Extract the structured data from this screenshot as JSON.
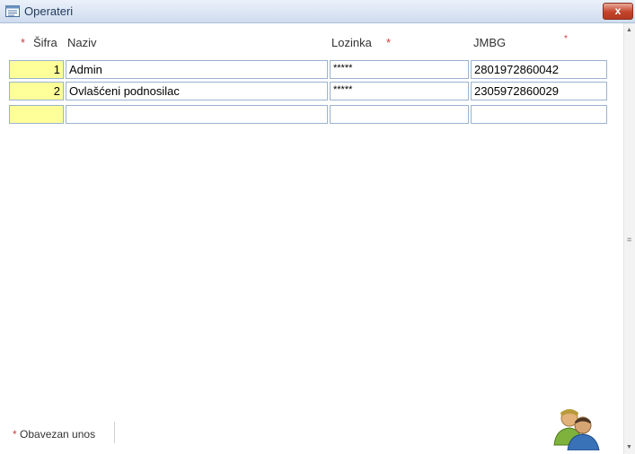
{
  "window": {
    "title": "Operateri",
    "close_label": "x"
  },
  "columns": {
    "sifra": "Šifra",
    "naziv": "Naziv",
    "lozinka": "Lozinka",
    "jmbg": "JMBG",
    "required_mark": "*"
  },
  "rows": [
    {
      "sifra": "1",
      "naziv": "Admin",
      "lozinka": "*****",
      "jmbg": "2801972860042"
    },
    {
      "sifra": "2",
      "naziv": "Ovlašćeni podnosilac",
      "lozinka": "*****",
      "jmbg": "2305972860029"
    },
    {
      "sifra": "",
      "naziv": "",
      "lozinka": "",
      "jmbg": ""
    }
  ],
  "footer": {
    "required_mark": "*",
    "required_text": "Obavezan unos"
  },
  "icons": {
    "title": "form-icon",
    "footer": "users-icon"
  },
  "colors": {
    "id_cell_bg": "#ffff99",
    "required": "#d23b3b",
    "cell_border": "#9ab3d0"
  }
}
